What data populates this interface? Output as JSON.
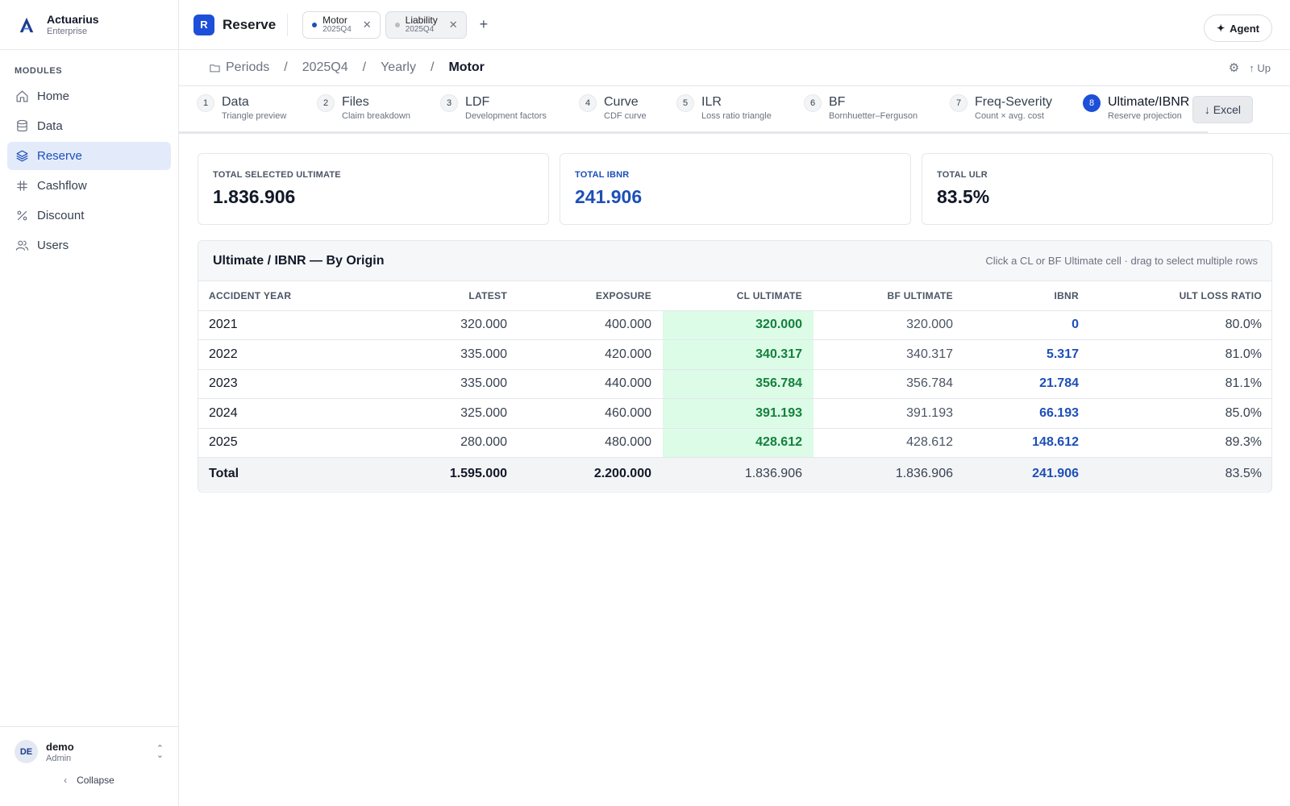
{
  "brand": {
    "name": "Actuarius",
    "subtitle": "Enterprise"
  },
  "sidebar": {
    "section_label": "MODULES",
    "items": [
      {
        "label": "Home",
        "icon": "home-icon"
      },
      {
        "label": "Data",
        "icon": "database-icon"
      },
      {
        "label": "Reserve",
        "icon": "layers-icon",
        "active": true
      },
      {
        "label": "Cashflow",
        "icon": "grid-icon"
      },
      {
        "label": "Discount",
        "icon": "percent-icon"
      },
      {
        "label": "Users",
        "icon": "users-icon"
      }
    ],
    "user": {
      "initials": "DE",
      "name": "demo",
      "role": "Admin"
    },
    "collapse_label": "Collapse"
  },
  "topbar": {
    "app_badge": "R",
    "app_title": "Reserve",
    "tabs": [
      {
        "name": "Motor",
        "period": "2025Q4",
        "active": true
      },
      {
        "name": "Liability",
        "period": "2025Q4",
        "active": false
      }
    ],
    "add_tab": "+",
    "agent_label": "Agent"
  },
  "breadcrumb": {
    "items": [
      "Periods",
      "2025Q4",
      "Yearly",
      "Motor"
    ],
    "separator": "/",
    "up_label": "Up"
  },
  "steps": [
    {
      "num": "1",
      "label": "Data",
      "sub": "Triangle preview"
    },
    {
      "num": "2",
      "label": "Files",
      "sub": "Claim breakdown"
    },
    {
      "num": "3",
      "label": "LDF",
      "sub": "Development factors"
    },
    {
      "num": "4",
      "label": "Curve",
      "sub": "CDF curve"
    },
    {
      "num": "5",
      "label": "ILR",
      "sub": "Loss ratio triangle"
    },
    {
      "num": "6",
      "label": "BF",
      "sub": "Bornhuetter–Ferguson"
    },
    {
      "num": "7",
      "label": "Freq-Severity",
      "sub": "Count × avg. cost"
    },
    {
      "num": "8",
      "label": "Ultimate/IBNR",
      "sub": "Reserve projection",
      "active": true
    }
  ],
  "excel_label": "Excel",
  "kpis": [
    {
      "label": "TOTAL SELECTED ULTIMATE",
      "value": "1.836.906"
    },
    {
      "label": "TOTAL IBNR",
      "value": "241.906"
    },
    {
      "label": "TOTAL ULR",
      "value": "83.5%"
    }
  ],
  "table": {
    "title": "Ultimate / IBNR — By Origin",
    "hint": "Click a CL or BF Ultimate cell · drag to select multiple rows",
    "columns": [
      "ACCIDENT YEAR",
      "LATEST",
      "EXPOSURE",
      "CL ULTIMATE",
      "BF ULTIMATE",
      "IBNR",
      "ULT LOSS RATIO"
    ],
    "rows": [
      [
        "2021",
        "320.000",
        "400.000",
        "320.000",
        "320.000",
        "0",
        "80.0%"
      ],
      [
        "2022",
        "335.000",
        "420.000",
        "340.317",
        "340.317",
        "5.317",
        "81.0%"
      ],
      [
        "2023",
        "335.000",
        "440.000",
        "356.784",
        "356.784",
        "21.784",
        "81.1%"
      ],
      [
        "2024",
        "325.000",
        "460.000",
        "391.193",
        "391.193",
        "66.193",
        "85.0%"
      ],
      [
        "2025",
        "280.000",
        "480.000",
        "428.612",
        "428.612",
        "148.612",
        "89.3%"
      ]
    ],
    "total": [
      "Total",
      "1.595.000",
      "2.200.000",
      "1.836.906",
      "1.836.906",
      "241.906",
      "83.5%"
    ]
  },
  "colors": {
    "accent": "#1d4fd8",
    "selected_cell_bg": "#dcfce7",
    "selected_cell_text": "#15803d",
    "ibnr_text": "#1d4fb8"
  }
}
